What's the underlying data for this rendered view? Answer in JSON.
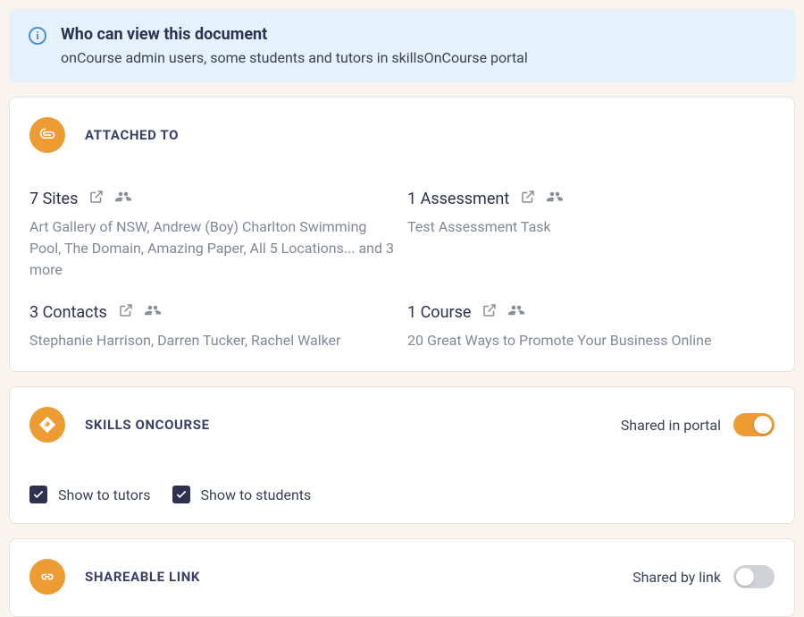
{
  "banner": {
    "title": "Who can view this document",
    "subtitle": "onCourse admin users, some students and tutors in skillsOnCourse portal"
  },
  "attached": {
    "section_title": "ATTACHED TO",
    "items": [
      {
        "heading": "7 Sites",
        "detail": "Art Gallery of NSW, Andrew (Boy) Charlton Swimming Pool, The Domain, Amazing Paper, All 5 Locations... and 3 more"
      },
      {
        "heading": "1 Assessment",
        "detail": "Test Assessment Task"
      },
      {
        "heading": "3 Contacts",
        "detail": "Stephanie Harrison, Darren Tucker, Rachel Walker"
      },
      {
        "heading": "1 Course",
        "detail": "20 Great Ways to Promote Your Business Online"
      }
    ]
  },
  "skills": {
    "section_title": "SKILLS ONCOURSE",
    "toggle_label": "Shared in portal",
    "toggle_state": "on",
    "checkbox1": "Show to tutors",
    "checkbox2": "Show to students"
  },
  "share": {
    "section_title": "SHAREABLE LINK",
    "toggle_label": "Shared by link",
    "toggle_state": "off"
  }
}
